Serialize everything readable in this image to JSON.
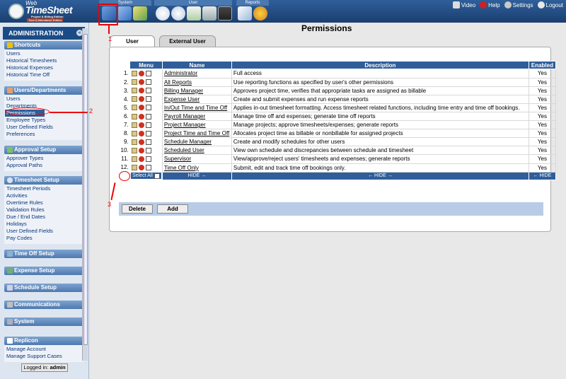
{
  "logo": {
    "web": "Web",
    "title": "TimeSheet",
    "edition1": "Project & Billing Edition",
    "edition2": "Time & Attendance Edition"
  },
  "toolbar_groups": [
    {
      "label": "System"
    },
    {
      "label": "User"
    },
    {
      "label": "Reports"
    }
  ],
  "top_links": {
    "video": "Video",
    "help": "Help",
    "settings": "Settings",
    "logout": "Logout"
  },
  "sidebar": {
    "header": "ADMINISTRATION",
    "sections": [
      {
        "title": "Shortcuts",
        "items": [
          "Users",
          "Historical Timesheets",
          "Historical Expenses",
          "Historical Time Off"
        ]
      },
      {
        "title": "Users/Departments",
        "items": [
          "Users",
          "Departments",
          "Permissions",
          "Employee Types",
          "User Defined Fields",
          "Preferences"
        ]
      },
      {
        "title": "Approval Setup",
        "items": [
          "Approver Types",
          "Approval Paths"
        ]
      },
      {
        "title": "Timesheet Setup",
        "items": [
          "Timesheet Periods",
          "Activities",
          "Overtime Rules",
          "Validation Rules",
          "Due / End Dates",
          "Holidays",
          "User Defined Fields",
          "Pay Codes"
        ]
      },
      {
        "title": "Time Off Setup",
        "items": []
      },
      {
        "title": "Expense Setup",
        "items": []
      },
      {
        "title": "Schedule Setup",
        "items": []
      },
      {
        "title": "Communications",
        "items": []
      },
      {
        "title": "System",
        "items": []
      },
      {
        "title": "Replicon",
        "items": [
          "Manage Account",
          "Manage Support Cases"
        ]
      }
    ],
    "logged_in_label": "Logged in:",
    "logged_in_user": "admin"
  },
  "page": {
    "title": "Permissions",
    "tabs": [
      "User",
      "External User"
    ],
    "columns": [
      "Menu",
      "Name",
      "Description",
      "Enabled"
    ],
    "rows": [
      {
        "n": "1.",
        "name": "Administrator",
        "desc": "Full access",
        "enabled": "Yes"
      },
      {
        "n": "2.",
        "name": "All Reports",
        "desc": "Use reporting functions as specified by user's other permissions",
        "enabled": "Yes"
      },
      {
        "n": "3.",
        "name": "Billing Manager",
        "desc": "Approves project time, verifies that appropriate tasks are assigned as billable",
        "enabled": "Yes"
      },
      {
        "n": "4.",
        "name": "Expense User",
        "desc": "Create and submit expenses and run expense reports",
        "enabled": "Yes"
      },
      {
        "n": "5.",
        "name": "In/Out Time and Time Off",
        "desc": "Applies in-out timesheet formatting. Access timesheet related functions, including time entry and time off bookings.",
        "enabled": "Yes"
      },
      {
        "n": "6.",
        "name": "Payroll Manager",
        "desc": "Manage time off and expenses; generate time off reports",
        "enabled": "Yes"
      },
      {
        "n": "7.",
        "name": "Project Manager",
        "desc": "Manage projects; approve timesheets/expenses; generate reports",
        "enabled": "Yes"
      },
      {
        "n": "8.",
        "name": "Project Time and Time Off",
        "desc": "Allocates project time as billable or nonbillable for assigned projects",
        "enabled": "Yes"
      },
      {
        "n": "9.",
        "name": "Schedule Manager",
        "desc": "Create and modify schedules for other users",
        "enabled": "Yes"
      },
      {
        "n": "10.",
        "name": "Scheduled User",
        "desc": "View own schedule and discrepancies between schedule and timesheet",
        "enabled": "Yes"
      },
      {
        "n": "11.",
        "name": "Supervisor",
        "desc": "View/approve/reject users' timesheets and expenses; generate reports",
        "enabled": "Yes"
      },
      {
        "n": "12.",
        "name": "Time Off Only",
        "desc": "Submit, edit and track time off bookings only.",
        "enabled": "Yes"
      }
    ],
    "footer": {
      "select_all": "Select All",
      "hide_name": "HIDE →",
      "hide_desc": "← HIDE →",
      "hide_en": "← HIDE"
    },
    "buttons": {
      "delete": "Delete",
      "add": "Add"
    }
  },
  "annotations": {
    "a1": "1",
    "a2": "2",
    "a3": "3"
  }
}
